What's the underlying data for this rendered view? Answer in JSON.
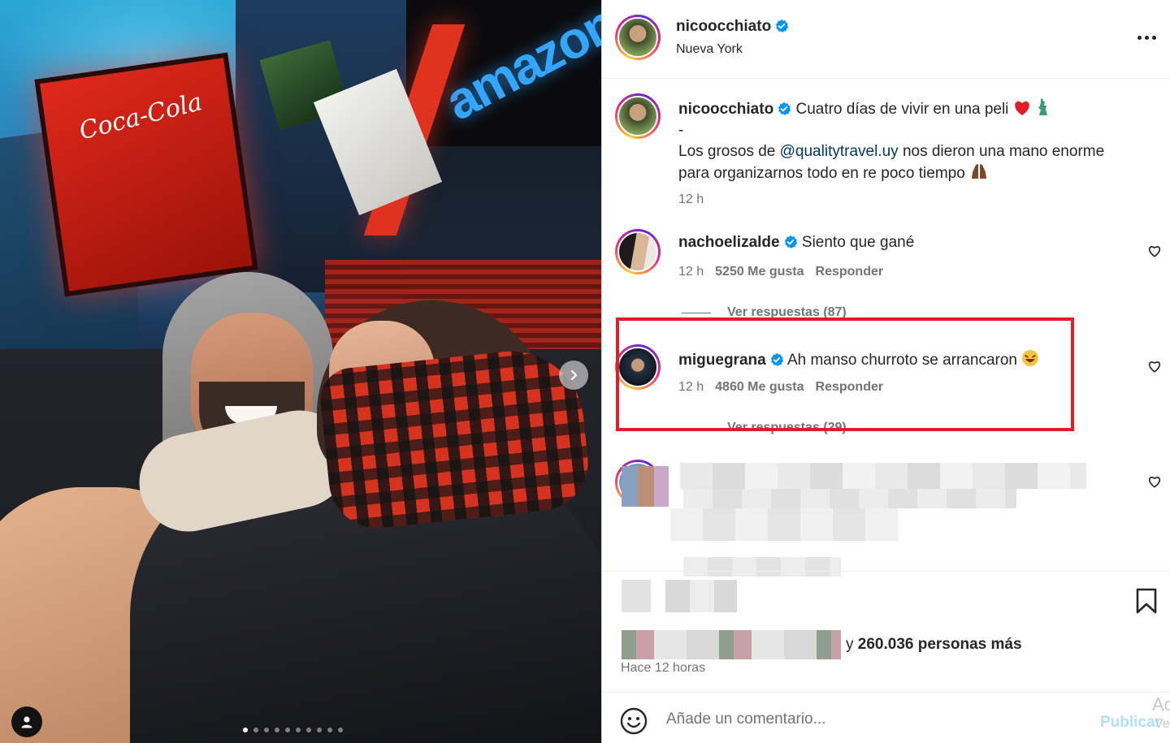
{
  "post": {
    "username": "nicoocchiato",
    "location": "Nueva York",
    "caption_line1": "Cuatro días de vivir en una peli",
    "caption_line2": "-",
    "caption_line3_before": "Los grosos de ",
    "caption_mention": "@qualitytravel.uy",
    "caption_line3_after": " nos dieron una mano enorme",
    "caption_line4": "para organizarnos todo en re poco tiempo",
    "caption_time": "12 h"
  },
  "comments": [
    {
      "username": "nachoelizalde",
      "text": "Siento que gané",
      "time": "12 h",
      "likes": "5250 Me gusta",
      "reply": "Responder",
      "view_replies": "Ver respuestas (87)"
    },
    {
      "username": "miguegrana",
      "text": "Ah manso churroto se arrancaron",
      "time": "12 h",
      "likes": "4860 Me gusta",
      "reply": "Responder",
      "view_replies": "Ver respuestas (29)"
    }
  ],
  "footer": {
    "likes_suffix_prefix": "y ",
    "likes_count": "260.036 personas más",
    "time": "Hace 12 horas",
    "comment_placeholder": "Añade un comentario...",
    "publish": "Publicar",
    "overlay_ac": "Ac",
    "overlay_ve": "Ve"
  },
  "photo": {
    "sign_coca_cola": "Coca-Cola",
    "sign_amazon": "amazon",
    "carousel_total": 10,
    "carousel_active": 1
  },
  "colors": {
    "accent_blue": "#0095f6",
    "highlight_red": "#dd1f26",
    "verified_blue": "#0095f6",
    "muted_text": "#737373"
  },
  "icons": [
    "more-options-icon",
    "verified-badge-icon",
    "heart-icon",
    "bookmark-icon",
    "emoji-smiley-icon",
    "chevron-right-icon",
    "user-tag-icon"
  ]
}
